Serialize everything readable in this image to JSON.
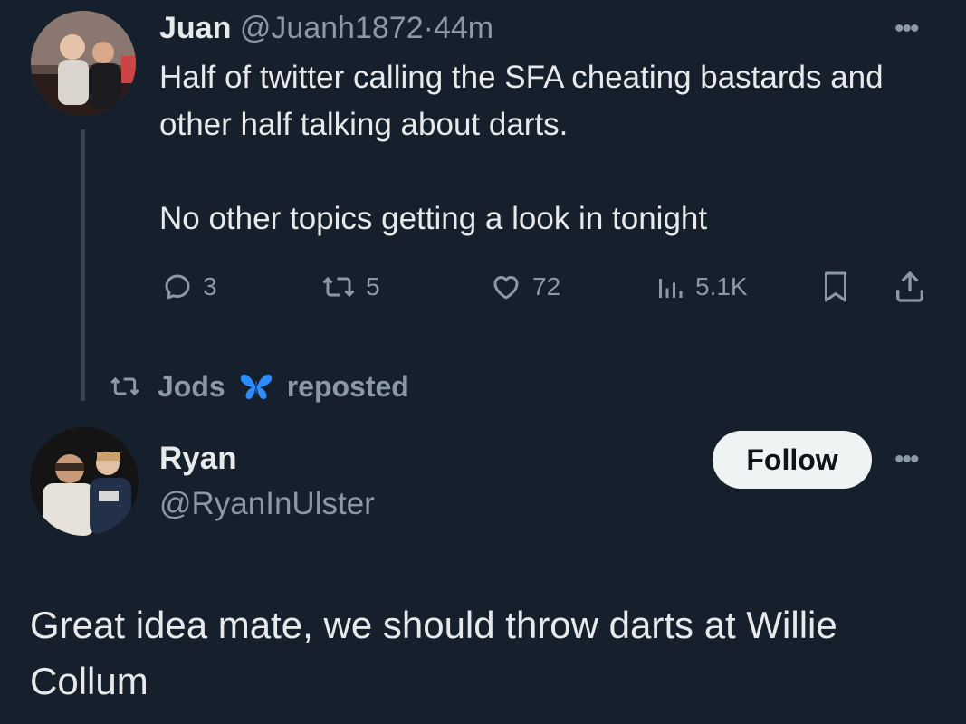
{
  "quoted_tweet": {
    "name": "Juan",
    "handle": "@Juanh1872",
    "separator": "·",
    "time": "44m",
    "text_line1": "Half of twitter calling the SFA cheating bastards and other half talking about darts.",
    "text_line2": "No other topics getting a look in tonight",
    "replies": "3",
    "reposts": "5",
    "likes": "72",
    "views": "5.1K",
    "more_label": "•••"
  },
  "repost_banner": {
    "user": "Jods",
    "badge_icon": "butterfly-icon",
    "action": "reposted"
  },
  "main_tweet": {
    "name": "Ryan",
    "handle": "@RyanInUlster",
    "follow_label": "Follow",
    "more_label": "•••",
    "text": "Great idea mate, we should throw darts at Willie Collum"
  },
  "colors": {
    "background": "#16202c",
    "text": "#e7e9ea",
    "muted": "#8b98a5",
    "follow_bg": "#eff3f4",
    "butterfly": "#2f8cff"
  },
  "icons": [
    "reply-icon",
    "repost-icon",
    "like-icon",
    "views-icon",
    "bookmark-icon",
    "share-icon",
    "more-icon"
  ]
}
